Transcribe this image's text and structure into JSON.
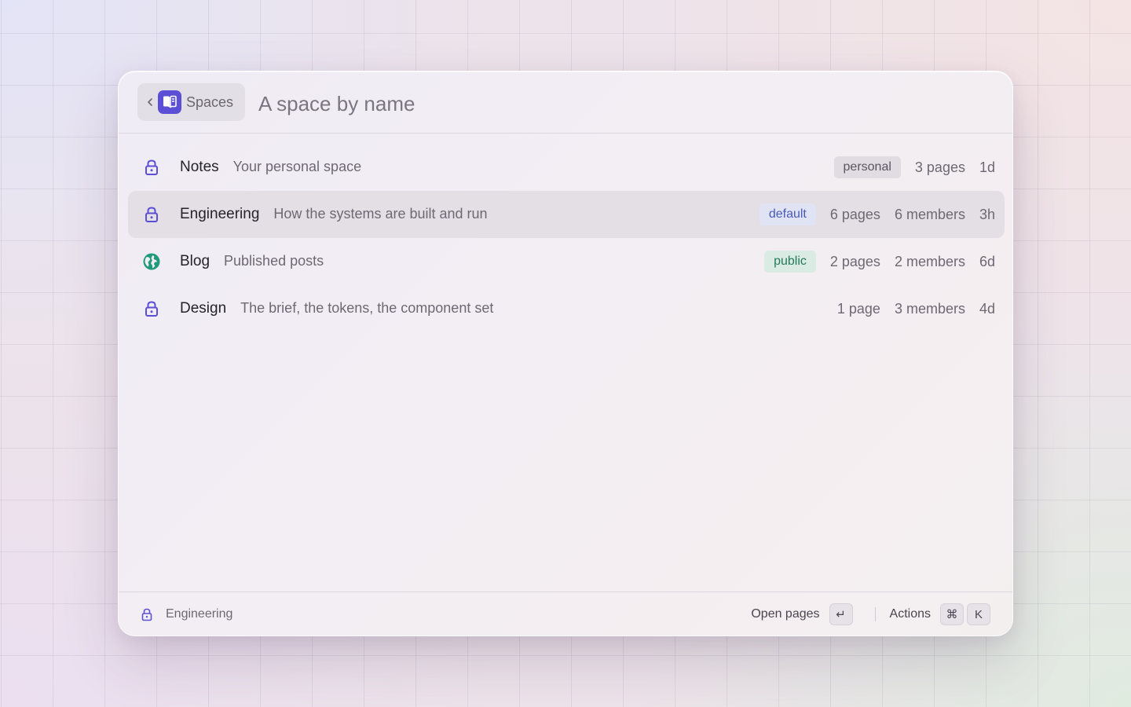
{
  "header": {
    "breadcrumb_label": "Spaces",
    "breadcrumb_icon": "book-icon",
    "search_placeholder": "A space by name",
    "search_value": ""
  },
  "colors": {
    "accent": "#5b4fd6",
    "lock_icon": "#5b4fd6",
    "globe_icon": "#1f9a7a"
  },
  "spaces": [
    {
      "icon": "lock-icon",
      "name": "Notes",
      "description": "Your personal space",
      "badge": "personal",
      "pages": "3 pages",
      "members": "",
      "age": "1d",
      "selected": false
    },
    {
      "icon": "lock-icon",
      "name": "Engineering",
      "description": "How the systems are built and run",
      "badge": "default",
      "pages": "6 pages",
      "members": "6 members",
      "age": "3h",
      "selected": true
    },
    {
      "icon": "globe-icon",
      "name": "Blog",
      "description": "Published posts",
      "badge": "public",
      "pages": "2 pages",
      "members": "2 members",
      "age": "6d",
      "selected": false
    },
    {
      "icon": "lock-icon",
      "name": "Design",
      "description": "The brief, the tokens, the component set",
      "badge": "",
      "pages": "1 page",
      "members": "3 members",
      "age": "4d",
      "selected": false
    }
  ],
  "footer": {
    "selected_label": "Engineering",
    "selected_icon": "lock-icon",
    "primary_action": "Open pages",
    "primary_key": "↵",
    "secondary_action": "Actions",
    "secondary_keys": [
      "⌘",
      "K"
    ]
  }
}
